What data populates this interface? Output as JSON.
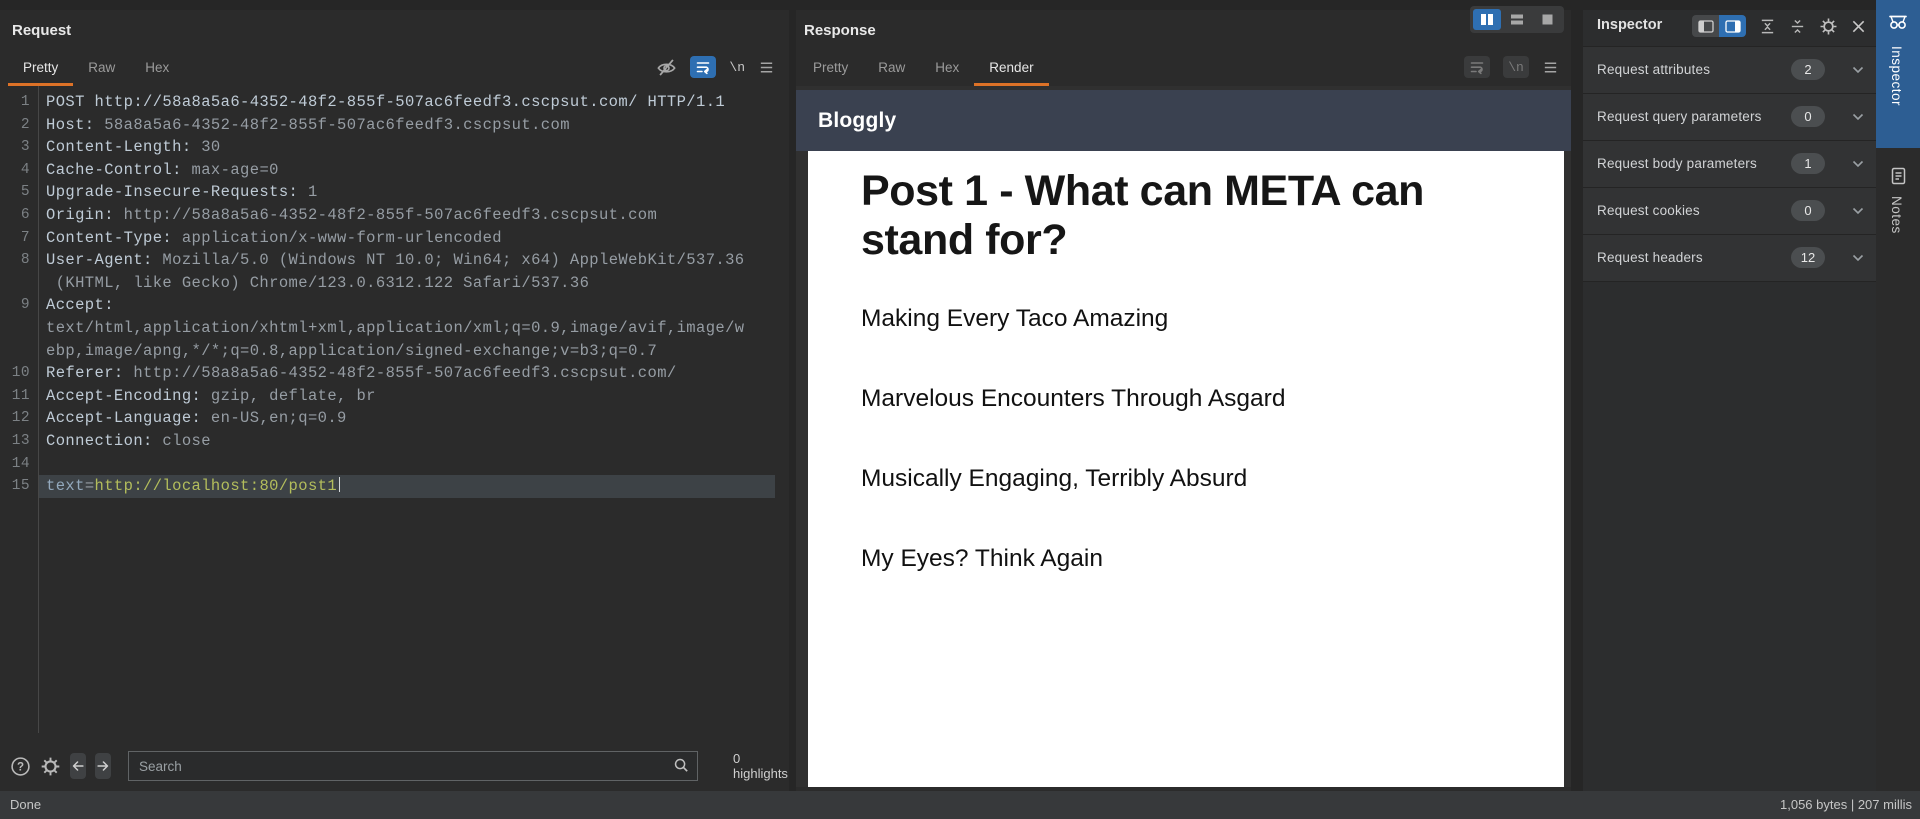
{
  "request": {
    "title": "Request",
    "tabs": [
      {
        "label": "Pretty",
        "active": true
      },
      {
        "label": "Raw",
        "active": false
      },
      {
        "label": "Hex",
        "active": false
      }
    ],
    "editor_lines": [
      {
        "n": "1",
        "parts": [
          [
            "k",
            "POST http://58a8a5a6-4352-48f2-855f-507ac6feedf3.cscpsut.com/ HTTP/1.1"
          ]
        ]
      },
      {
        "n": "2",
        "parts": [
          [
            "k",
            "Host:"
          ],
          [
            "v",
            " 58a8a5a6-4352-48f2-855f-507ac6feedf3.cscpsut.com"
          ]
        ]
      },
      {
        "n": "3",
        "parts": [
          [
            "k",
            "Content-Length:"
          ],
          [
            "v",
            " 30"
          ]
        ]
      },
      {
        "n": "4",
        "parts": [
          [
            "k",
            "Cache-Control:"
          ],
          [
            "v",
            " max-age=0"
          ]
        ]
      },
      {
        "n": "5",
        "parts": [
          [
            "k",
            "Upgrade-Insecure-Requests:"
          ],
          [
            "v",
            " 1"
          ]
        ]
      },
      {
        "n": "6",
        "parts": [
          [
            "k",
            "Origin:"
          ],
          [
            "v",
            " http://58a8a5a6-4352-48f2-855f-507ac6feedf3.cscpsut.com"
          ]
        ]
      },
      {
        "n": "7",
        "parts": [
          [
            "k",
            "Content-Type:"
          ],
          [
            "v",
            " application/x-www-form-urlencoded"
          ]
        ]
      },
      {
        "n": "8",
        "parts": [
          [
            "k",
            "User-Agent:"
          ],
          [
            "v",
            " Mozilla/5.0 (Windows NT 10.0; Win64; x64) AppleWebKit/537.36"
          ]
        ]
      },
      {
        "n": "",
        "parts": [
          [
            "v",
            " (KHTML, like Gecko) Chrome/123.0.6312.122 Safari/537.36"
          ]
        ]
      },
      {
        "n": "9",
        "parts": [
          [
            "k",
            "Accept:"
          ]
        ]
      },
      {
        "n": "",
        "parts": [
          [
            "v",
            "text/html,application/xhtml+xml,application/xml;q=0.9,image/avif,image/w"
          ]
        ]
      },
      {
        "n": "",
        "parts": [
          [
            "v",
            "ebp,image/apng,*/*;q=0.8,application/signed-exchange;v=b3;q=0.7"
          ]
        ]
      },
      {
        "n": "10",
        "parts": [
          [
            "k",
            "Referer:"
          ],
          [
            "v",
            " http://58a8a5a6-4352-48f2-855f-507ac6feedf3.cscpsut.com/"
          ]
        ]
      },
      {
        "n": "11",
        "parts": [
          [
            "k",
            "Accept-Encoding:"
          ],
          [
            "v",
            " gzip, deflate, br"
          ]
        ]
      },
      {
        "n": "12",
        "parts": [
          [
            "k",
            "Accept-Language:"
          ],
          [
            "v",
            " en-US,en;q=0.9"
          ]
        ]
      },
      {
        "n": "13",
        "parts": [
          [
            "k",
            "Connection:"
          ],
          [
            "v",
            " close"
          ]
        ]
      },
      {
        "n": "14",
        "parts": []
      },
      {
        "n": "15",
        "selected": true,
        "caret": true,
        "parts": [
          [
            "p",
            "text"
          ],
          [
            "v",
            "="
          ],
          [
            "g",
            "http://localhost:80/post1"
          ]
        ]
      }
    ],
    "search": {
      "placeholder": "Search",
      "highlights": "0 highlights"
    }
  },
  "response": {
    "title": "Response",
    "tabs": [
      {
        "label": "Pretty",
        "active": false
      },
      {
        "label": "Raw",
        "active": false
      },
      {
        "label": "Hex",
        "active": false
      },
      {
        "label": "Render",
        "active": true
      }
    ],
    "render": {
      "site_title": "Bloggly",
      "post_title": "Post 1 - What can META can stand for?",
      "paragraphs": [
        "Making Every Taco Amazing",
        "Marvelous Encounters Through Asgard",
        "Musically Engaging, Terribly Absurd",
        "My Eyes? Think Again"
      ]
    }
  },
  "inspector": {
    "title": "Inspector",
    "sections": [
      {
        "label": "Request attributes",
        "count": "2"
      },
      {
        "label": "Request query parameters",
        "count": "0"
      },
      {
        "label": "Request body parameters",
        "count": "1"
      },
      {
        "label": "Request cookies",
        "count": "0"
      },
      {
        "label": "Request headers",
        "count": "12"
      }
    ],
    "rail": {
      "top_tab": "Inspector",
      "notes_tab": "Notes"
    }
  },
  "statusbar": {
    "left": "Done",
    "right": "1,056 bytes | 207 millis"
  },
  "colors": {
    "accent_orange": "#dd7227",
    "accent_blue": "#2e6fb2",
    "rail_blue": "#2d5e93",
    "site_nav_bg": "#3a4150",
    "body_value_green": "#b3bd5c"
  }
}
